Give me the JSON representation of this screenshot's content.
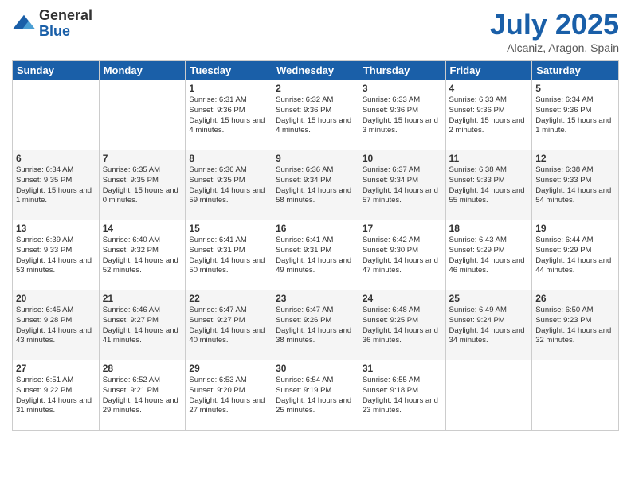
{
  "logo": {
    "general": "General",
    "blue": "Blue"
  },
  "header": {
    "month": "July 2025",
    "location": "Alcaniz, Aragon, Spain"
  },
  "weekdays": [
    "Sunday",
    "Monday",
    "Tuesday",
    "Wednesday",
    "Thursday",
    "Friday",
    "Saturday"
  ],
  "weeks": [
    [
      {
        "day": "",
        "info": ""
      },
      {
        "day": "",
        "info": ""
      },
      {
        "day": "1",
        "info": "Sunrise: 6:31 AM\nSunset: 9:36 PM\nDaylight: 15 hours and 4 minutes."
      },
      {
        "day": "2",
        "info": "Sunrise: 6:32 AM\nSunset: 9:36 PM\nDaylight: 15 hours and 4 minutes."
      },
      {
        "day": "3",
        "info": "Sunrise: 6:33 AM\nSunset: 9:36 PM\nDaylight: 15 hours and 3 minutes."
      },
      {
        "day": "4",
        "info": "Sunrise: 6:33 AM\nSunset: 9:36 PM\nDaylight: 15 hours and 2 minutes."
      },
      {
        "day": "5",
        "info": "Sunrise: 6:34 AM\nSunset: 9:36 PM\nDaylight: 15 hours and 1 minute."
      }
    ],
    [
      {
        "day": "6",
        "info": "Sunrise: 6:34 AM\nSunset: 9:35 PM\nDaylight: 15 hours and 1 minute."
      },
      {
        "day": "7",
        "info": "Sunrise: 6:35 AM\nSunset: 9:35 PM\nDaylight: 15 hours and 0 minutes."
      },
      {
        "day": "8",
        "info": "Sunrise: 6:36 AM\nSunset: 9:35 PM\nDaylight: 14 hours and 59 minutes."
      },
      {
        "day": "9",
        "info": "Sunrise: 6:36 AM\nSunset: 9:34 PM\nDaylight: 14 hours and 58 minutes."
      },
      {
        "day": "10",
        "info": "Sunrise: 6:37 AM\nSunset: 9:34 PM\nDaylight: 14 hours and 57 minutes."
      },
      {
        "day": "11",
        "info": "Sunrise: 6:38 AM\nSunset: 9:33 PM\nDaylight: 14 hours and 55 minutes."
      },
      {
        "day": "12",
        "info": "Sunrise: 6:38 AM\nSunset: 9:33 PM\nDaylight: 14 hours and 54 minutes."
      }
    ],
    [
      {
        "day": "13",
        "info": "Sunrise: 6:39 AM\nSunset: 9:33 PM\nDaylight: 14 hours and 53 minutes."
      },
      {
        "day": "14",
        "info": "Sunrise: 6:40 AM\nSunset: 9:32 PM\nDaylight: 14 hours and 52 minutes."
      },
      {
        "day": "15",
        "info": "Sunrise: 6:41 AM\nSunset: 9:31 PM\nDaylight: 14 hours and 50 minutes."
      },
      {
        "day": "16",
        "info": "Sunrise: 6:41 AM\nSunset: 9:31 PM\nDaylight: 14 hours and 49 minutes."
      },
      {
        "day": "17",
        "info": "Sunrise: 6:42 AM\nSunset: 9:30 PM\nDaylight: 14 hours and 47 minutes."
      },
      {
        "day": "18",
        "info": "Sunrise: 6:43 AM\nSunset: 9:29 PM\nDaylight: 14 hours and 46 minutes."
      },
      {
        "day": "19",
        "info": "Sunrise: 6:44 AM\nSunset: 9:29 PM\nDaylight: 14 hours and 44 minutes."
      }
    ],
    [
      {
        "day": "20",
        "info": "Sunrise: 6:45 AM\nSunset: 9:28 PM\nDaylight: 14 hours and 43 minutes."
      },
      {
        "day": "21",
        "info": "Sunrise: 6:46 AM\nSunset: 9:27 PM\nDaylight: 14 hours and 41 minutes."
      },
      {
        "day": "22",
        "info": "Sunrise: 6:47 AM\nSunset: 9:27 PM\nDaylight: 14 hours and 40 minutes."
      },
      {
        "day": "23",
        "info": "Sunrise: 6:47 AM\nSunset: 9:26 PM\nDaylight: 14 hours and 38 minutes."
      },
      {
        "day": "24",
        "info": "Sunrise: 6:48 AM\nSunset: 9:25 PM\nDaylight: 14 hours and 36 minutes."
      },
      {
        "day": "25",
        "info": "Sunrise: 6:49 AM\nSunset: 9:24 PM\nDaylight: 14 hours and 34 minutes."
      },
      {
        "day": "26",
        "info": "Sunrise: 6:50 AM\nSunset: 9:23 PM\nDaylight: 14 hours and 32 minutes."
      }
    ],
    [
      {
        "day": "27",
        "info": "Sunrise: 6:51 AM\nSunset: 9:22 PM\nDaylight: 14 hours and 31 minutes."
      },
      {
        "day": "28",
        "info": "Sunrise: 6:52 AM\nSunset: 9:21 PM\nDaylight: 14 hours and 29 minutes."
      },
      {
        "day": "29",
        "info": "Sunrise: 6:53 AM\nSunset: 9:20 PM\nDaylight: 14 hours and 27 minutes."
      },
      {
        "day": "30",
        "info": "Sunrise: 6:54 AM\nSunset: 9:19 PM\nDaylight: 14 hours and 25 minutes."
      },
      {
        "day": "31",
        "info": "Sunrise: 6:55 AM\nSunset: 9:18 PM\nDaylight: 14 hours and 23 minutes."
      },
      {
        "day": "",
        "info": ""
      },
      {
        "day": "",
        "info": ""
      }
    ]
  ]
}
